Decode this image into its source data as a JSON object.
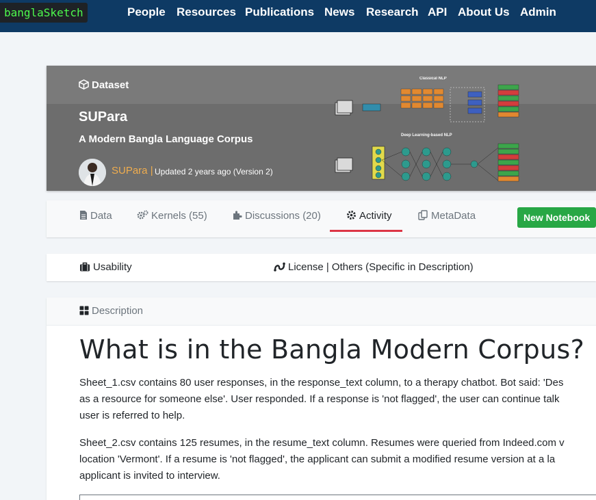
{
  "brand": {
    "logo": "banglaSketch"
  },
  "nav": [
    "People",
    "Resources",
    "Publications",
    "News",
    "Research",
    "API",
    "About Us",
    "Admin"
  ],
  "hero": {
    "type_label": "Dataset",
    "title": "SUPara",
    "subtitle": "A Modern Bangla Language Corpus",
    "owner": "SUPara |",
    "updated": "Updated 2 years ago (Version 2)",
    "figure": {
      "top_title": "Classical NLP",
      "bottom_title": "Deep Learning-based NLP"
    }
  },
  "tabs": [
    {
      "label": "Data",
      "icon": "file-icon"
    },
    {
      "label": "Kernels (55)",
      "icon": "gears-icon"
    },
    {
      "label": "Discussions (20)",
      "icon": "puzzle-icon"
    },
    {
      "label": "Activity",
      "icon": "gear-icon",
      "active": true
    },
    {
      "label": "MetaData",
      "icon": "copy-icon"
    }
  ],
  "new_notebook": "New Notebook",
  "info": {
    "usability": "Usability",
    "license": "License | Others (Specific in Description)"
  },
  "description": {
    "label": "Description",
    "heading": "What is in the Bangla Modern Corpus?",
    "p1": [
      "Sheet_1.csv contains 80 user responses, in the response_text column, to a therapy chatbot. Bot said: 'Des",
      "as a resource for someone else'. User responded. If a response is 'not flagged', the user can continue talk",
      "user is referred to help."
    ],
    "p2": [
      "Sheet_2.csv contains 125 resumes, in the resume_text column. Resumes were queried from Indeed.com v",
      "location 'Vermont'. If a resume is 'not flagged', the applicant can submit a modified resume version at a la",
      "applicant is invited to interview."
    ]
  },
  "colors": {
    "nav_bg": "#0e3a64",
    "logo_text": "#4dfa4d",
    "owner": "#f0ad4e",
    "active_tab": "#dc3545",
    "new_notebook": "#28a745"
  }
}
